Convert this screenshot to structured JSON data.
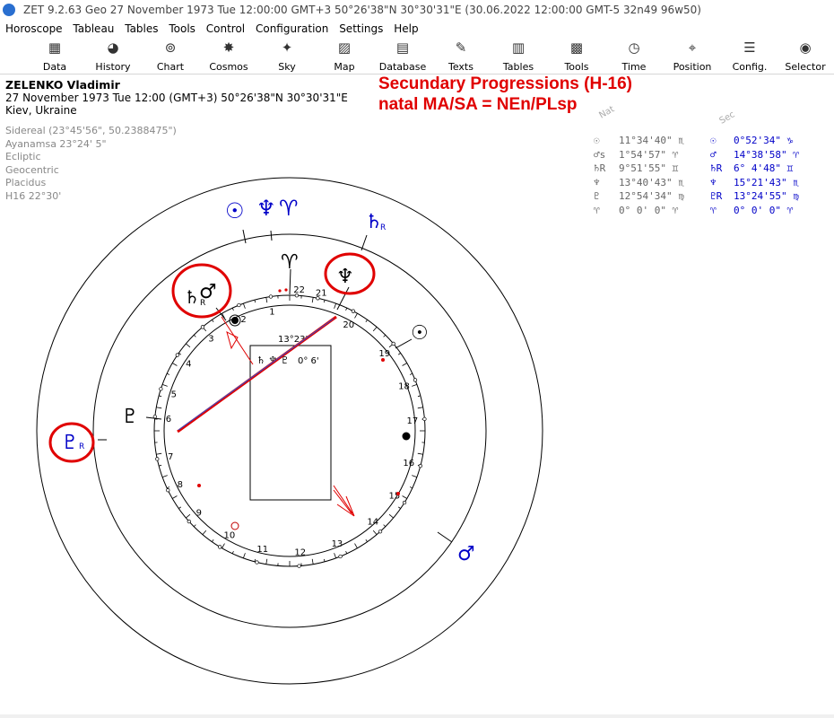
{
  "window": {
    "title": "ZET 9.2.63 Geo   27 November 1973  Tue  12:00:00 GMT+3 50°26'38\"N  30°30'31\"E  (30.06.2022  12:00:00 GMT-5 32n49 96w50)"
  },
  "menu": [
    "Horoscope",
    "Tableau",
    "Tables",
    "Tools",
    "Control",
    "Configuration",
    "Settings",
    "Help"
  ],
  "toolbar": [
    {
      "label": "Data",
      "icon": "data-icon",
      "glyph": "▦"
    },
    {
      "label": "History",
      "icon": "history-icon",
      "glyph": "◕"
    },
    {
      "label": "Chart",
      "icon": "chart-icon",
      "glyph": "⊚"
    },
    {
      "label": "Cosmos",
      "icon": "cosmos-icon",
      "glyph": "✸"
    },
    {
      "label": "Sky",
      "icon": "sky-icon",
      "glyph": "✦"
    },
    {
      "label": "Map",
      "icon": "map-icon",
      "glyph": "▨"
    },
    {
      "label": "Database",
      "icon": "database-icon",
      "glyph": "▤"
    },
    {
      "label": "Texts",
      "icon": "texts-icon",
      "glyph": "✎"
    },
    {
      "label": "Tables",
      "icon": "tables-icon",
      "glyph": "▥"
    },
    {
      "label": "Tools",
      "icon": "tools-icon",
      "glyph": "▩"
    },
    {
      "label": "Time",
      "icon": "time-icon",
      "glyph": "◷"
    },
    {
      "label": "Position",
      "icon": "position-icon",
      "glyph": "⌖"
    },
    {
      "label": "Config.",
      "icon": "config-icon",
      "glyph": "☰"
    },
    {
      "label": "Selector",
      "icon": "selector-icon",
      "glyph": "◉"
    }
  ],
  "person": {
    "name": "ZELENKO Vladimir",
    "datetime": "27 November 1973  Tue  12:00 (GMT+3) 50°26'38\"N  30°30'31\"E",
    "place": "Kiev, Ukraine"
  },
  "settings": [
    "Sidereal (23°45'56\", 50.2388475\")",
    "Ayanamsa 23°24' 5\"",
    "Ecliptic",
    "Geocentric",
    "Placidus",
    "H16  22°30'"
  ],
  "progression_title": [
    "Secundary Progressions (H-16)",
    "natal MA/SA = NEn/PLsp"
  ],
  "table_headers": {
    "natal": "Nat",
    "secondary": "Sec"
  },
  "positions": [
    {
      "natal_glyph": "☉",
      "natal_value": "11°34'40\" ♏",
      "sec_glyph": "☉",
      "sec_value": "0°52'34\" ♑"
    },
    {
      "natal_glyph": "♂s",
      "natal_value": "1°54'57\" ♈",
      "sec_glyph": "♂",
      "sec_value": "14°38'58\" ♈"
    },
    {
      "natal_glyph": "♄R",
      "natal_value": "9°51'55\" ♊",
      "sec_glyph": "♄R",
      "sec_value": "6° 4'48\" ♊"
    },
    {
      "natal_glyph": "♆",
      "natal_value": "13°40'43\" ♏",
      "sec_glyph": "♆",
      "sec_value": "15°21'43\" ♏"
    },
    {
      "natal_glyph": "♇",
      "natal_value": "12°54'34\" ♍",
      "sec_glyph": "♇R",
      "sec_value": "13°24'55\" ♍"
    },
    {
      "natal_glyph": "♈",
      "natal_value": "0° 0' 0\" ♈",
      "sec_glyph": "♈",
      "sec_value": "0° 0' 0\" ♈"
    }
  ],
  "chart": {
    "center_box": {
      "label_top": "13°23'",
      "glyphs": "♄ ♆ ♇",
      "value": "0° 6'"
    },
    "house_numbers": [
      "1",
      "2",
      "3",
      "4",
      "5",
      "6",
      "7",
      "8",
      "9",
      "10",
      "11",
      "12",
      "13",
      "14",
      "15",
      "16",
      "17",
      "18",
      "19",
      "20",
      "21",
      "22"
    ],
    "inner_glyphs": [
      {
        "name": "natal-aries-point",
        "glyph": "♈",
        "color": "#000000"
      },
      {
        "name": "natal-neptune",
        "glyph": "♆",
        "color": "#000000"
      },
      {
        "name": "natal-saturn",
        "glyph": "♄",
        "suffix": "R",
        "color": "#000000"
      },
      {
        "name": "natal-mars",
        "glyph": "♂",
        "color": "#000000"
      },
      {
        "name": "natal-sun",
        "glyph": "☉",
        "color": "#000000"
      },
      {
        "name": "natal-pluto",
        "glyph": "♇",
        "color": "#000000"
      }
    ],
    "outer_glyphs": [
      {
        "name": "sec-sun",
        "glyph": "☉",
        "color": "#0000c8"
      },
      {
        "name": "sec-neptune",
        "glyph": "♆",
        "color": "#0000c8"
      },
      {
        "name": "sec-aries-point",
        "glyph": "♈",
        "color": "#0000c8"
      },
      {
        "name": "sec-saturn",
        "glyph": "♄",
        "suffix": "R",
        "color": "#0000c8"
      },
      {
        "name": "sec-pluto",
        "glyph": "♇",
        "suffix": "R",
        "color": "#0000c8"
      },
      {
        "name": "sec-mars",
        "glyph": "♂",
        "color": "#0000c8"
      }
    ],
    "colors": {
      "highlight": "#e00000",
      "secondary": "#0000c8",
      "natal": "#000000"
    }
  }
}
